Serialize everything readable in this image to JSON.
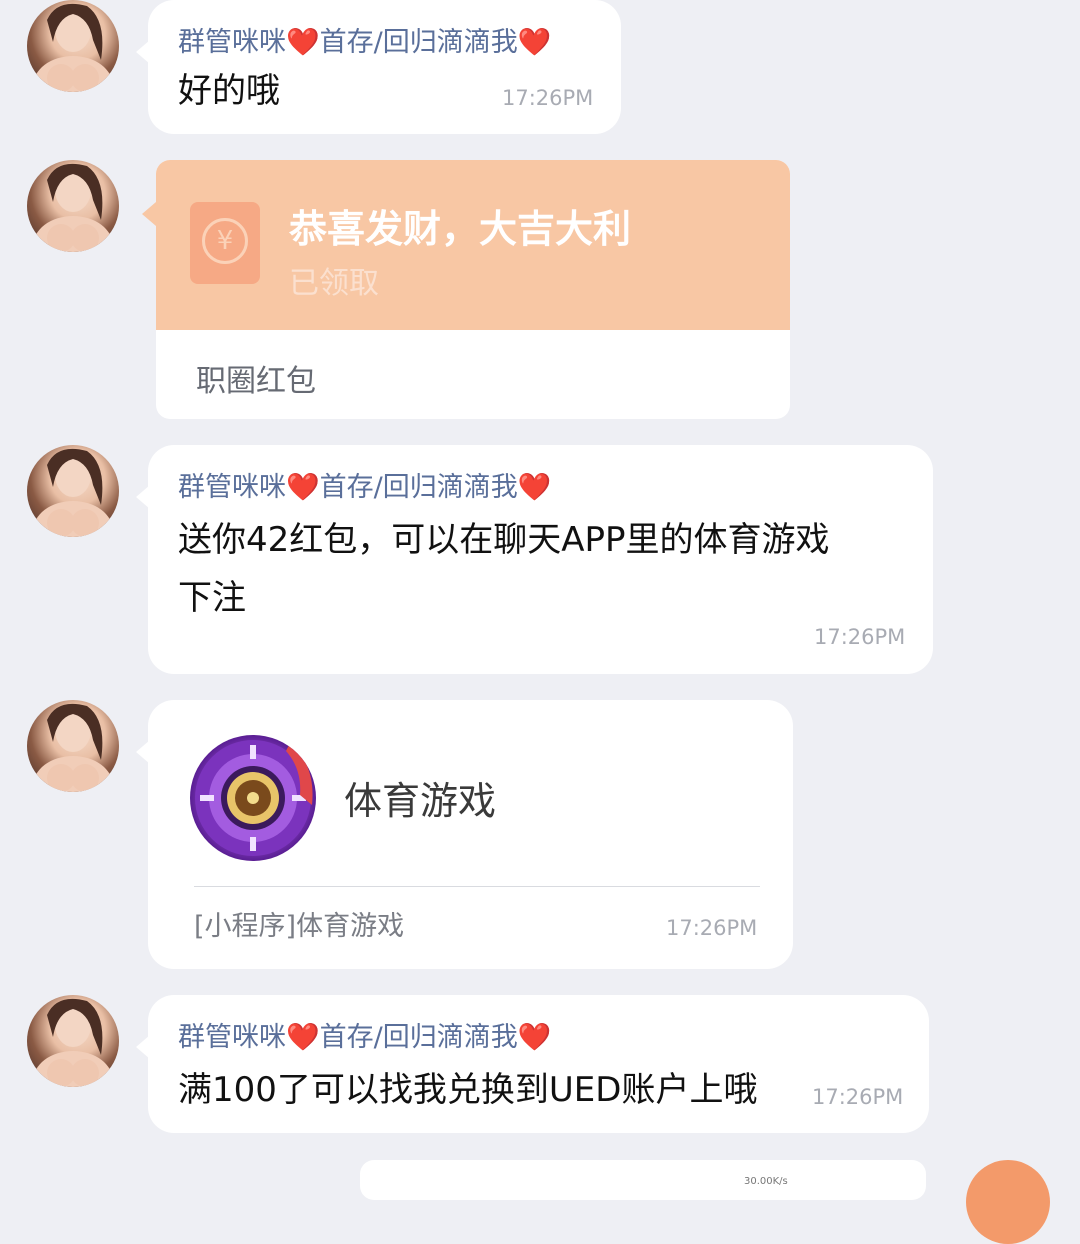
{
  "colors": {
    "background": "#eeeff4",
    "bubble": "#ffffff",
    "sender_name": "#5a6f9a",
    "timestamp": "#a8abb3",
    "red_packet": "#f8c7a4",
    "heart": "#e8262b"
  },
  "messages": [
    {
      "sender": "群管咪咪❤️首存/回归滴滴我❤️",
      "text": "好的哦",
      "time": "17:26PM"
    },
    {
      "red_packet": {
        "title": "恭喜发财，大吉大利",
        "status": "已领取",
        "footer": "职圈红包",
        "icon": "yen-coin-icon"
      }
    },
    {
      "sender": "群管咪咪❤️首存/回归滴滴我❤️",
      "text_line1": "送你42红包，可以在聊天APP里的体育游戏",
      "text_line2": "下注",
      "time": "17:26PM"
    },
    {
      "mini_program": {
        "title": "体育游戏",
        "label": "[小程序]体育游戏",
        "time": "17:26PM",
        "icon": "roulette-chip-icon"
      }
    },
    {
      "sender": "群管咪咪❤️首存/回归滴滴我❤️",
      "text": "满100了可以找我兑换到UED账户上哦",
      "time": "17:26PM"
    }
  ],
  "bottom_partial": {
    "text": "30.00K/s"
  }
}
